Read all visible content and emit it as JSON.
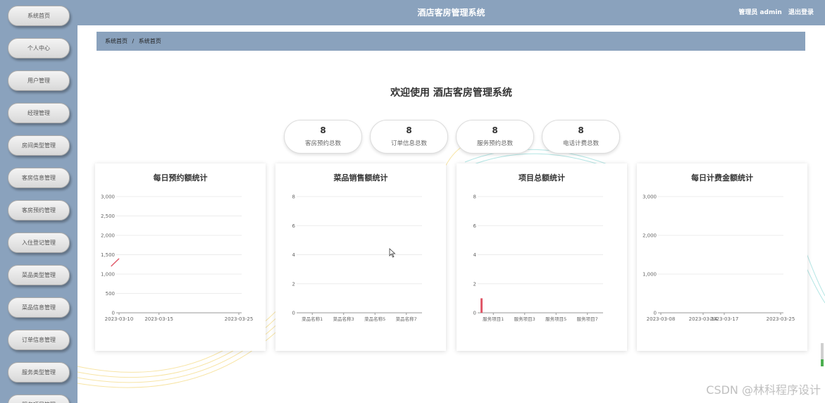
{
  "sidebar": {
    "items": [
      {
        "label": "系统首页"
      },
      {
        "label": "个人中心"
      },
      {
        "label": "用户管理"
      },
      {
        "label": "经理管理"
      },
      {
        "label": "房间类型管理"
      },
      {
        "label": "客房信息管理"
      },
      {
        "label": "客房预约管理"
      },
      {
        "label": "入住登记管理"
      },
      {
        "label": "菜品类型管理"
      },
      {
        "label": "菜品信息管理"
      },
      {
        "label": "订单信息管理"
      },
      {
        "label": "服务类型管理"
      },
      {
        "label": "服务项目管理"
      }
    ]
  },
  "header": {
    "title": "酒店客房管理系统",
    "user_label": "管理员 admin",
    "logout_label": "退出登录"
  },
  "breadcrumb": {
    "home": "系统首页",
    "separator": "/",
    "current": "系统首页"
  },
  "welcome": "欢迎使用 酒店客房管理系统",
  "stats": [
    {
      "value": "8",
      "label": "客房预约总数"
    },
    {
      "value": "8",
      "label": "订单信息总数"
    },
    {
      "value": "8",
      "label": "服务预约总数"
    },
    {
      "value": "8",
      "label": "电话计费总数"
    }
  ],
  "chart_data": [
    {
      "type": "line",
      "title": "每日预约额统计",
      "ylim": [
        0,
        3000
      ],
      "yticks": [
        "0",
        "500",
        "1,000",
        "1,500",
        "2,000",
        "2,500",
        "3,000"
      ],
      "x_tick_labels": [
        "2023-03-10",
        "2023-03-15",
        "2023-03-25"
      ],
      "series": [
        {
          "x": [
            "2023-03-09",
            "2023-03-10"
          ],
          "values": [
            1200,
            1400
          ]
        }
      ],
      "color": "#e05a6a",
      "grid": true
    },
    {
      "type": "bar",
      "title": "菜品销售额统计",
      "ylim": [
        0,
        8
      ],
      "yticks": [
        "0",
        "2",
        "4",
        "6",
        "8"
      ],
      "categories": [
        "菜品名称1",
        "菜品名称3",
        "菜品名称5",
        "菜品名称7"
      ],
      "values": [
        0,
        0,
        0,
        0
      ],
      "color": "#e05a6a",
      "grid": true
    },
    {
      "type": "bar",
      "title": "项目总额统计",
      "ylim": [
        0,
        8
      ],
      "yticks": [
        "0",
        "2",
        "4",
        "6",
        "8"
      ],
      "categories": [
        "服务项目1",
        "服务项目3",
        "服务项目5",
        "服务项目7"
      ],
      "values": [
        1,
        0,
        0,
        0
      ],
      "color": "#e05a6a",
      "grid": true
    },
    {
      "type": "line",
      "title": "每日计费金额统计",
      "ylim": [
        0,
        3000
      ],
      "yticks": [
        "0",
        "1,000",
        "2,000",
        "3,000"
      ],
      "x_tick_labels": [
        "2023-03-08",
        "2023-03-14",
        "2023-03-17",
        "2023-03-25"
      ],
      "series": [],
      "color": "#e05a6a",
      "grid": true
    }
  ],
  "watermark": "CSDN @林科程序设计",
  "colors": {
    "bar": "#8aa2bd",
    "accent": "#e05a6a"
  }
}
